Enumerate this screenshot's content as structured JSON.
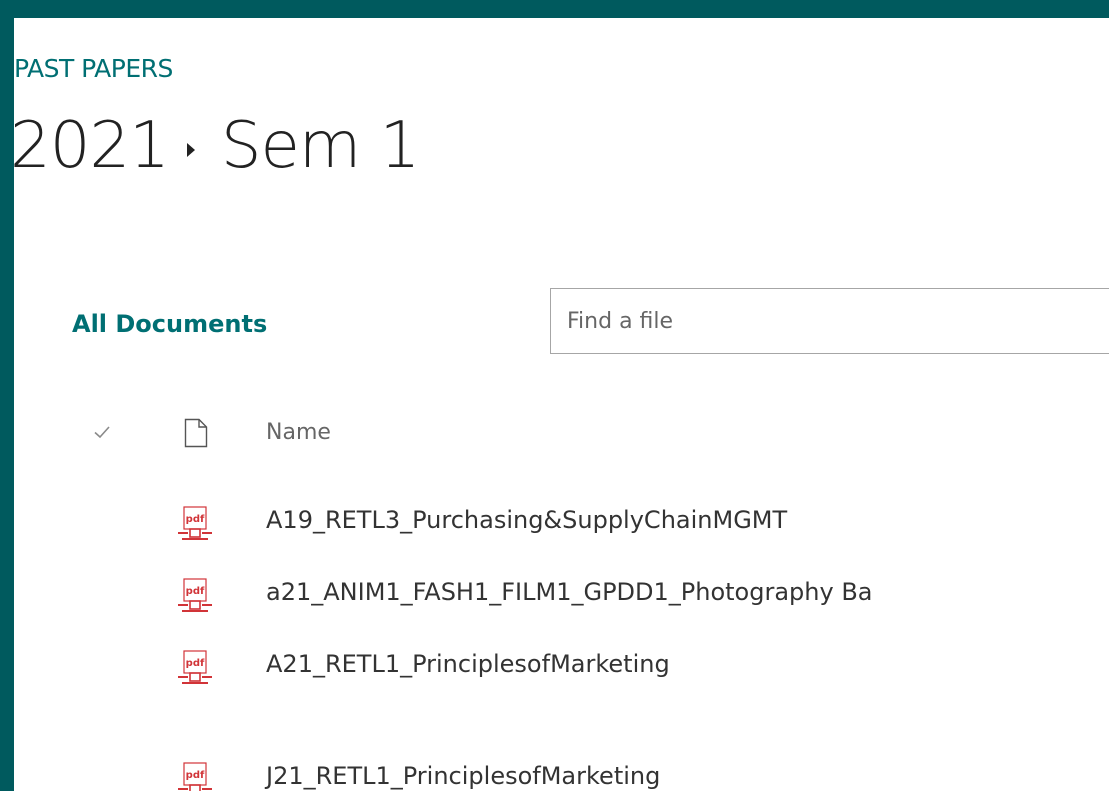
{
  "site": {
    "name": "PAST PAPERS"
  },
  "breadcrumb": {
    "items": [
      "2021",
      "Sem 1"
    ]
  },
  "view": {
    "label": "All Documents"
  },
  "search": {
    "placeholder": "Find a file",
    "value": ""
  },
  "list": {
    "columns": {
      "name": "Name"
    },
    "files": [
      {
        "name": "A19_RETL3_Purchasing&SupplyChainMGMT",
        "type": "pdf"
      },
      {
        "name": "a21_ANIM1_FASH1_FILM1_GPDD1_Photography Ba",
        "type": "pdf"
      },
      {
        "name": "A21_RETL1_PrinciplesofMarketing",
        "type": "pdf"
      },
      {
        "name": "J21_RETL1_PrinciplesofMarketing",
        "type": "pdf"
      }
    ]
  },
  "icons": {
    "select_all": "check-icon",
    "file_type_header": "document-icon",
    "file_type_row": "pdf-file-icon"
  },
  "colors": {
    "frame": "#005a5e",
    "accent": "#006f73",
    "pdf_red": "#d13438"
  }
}
